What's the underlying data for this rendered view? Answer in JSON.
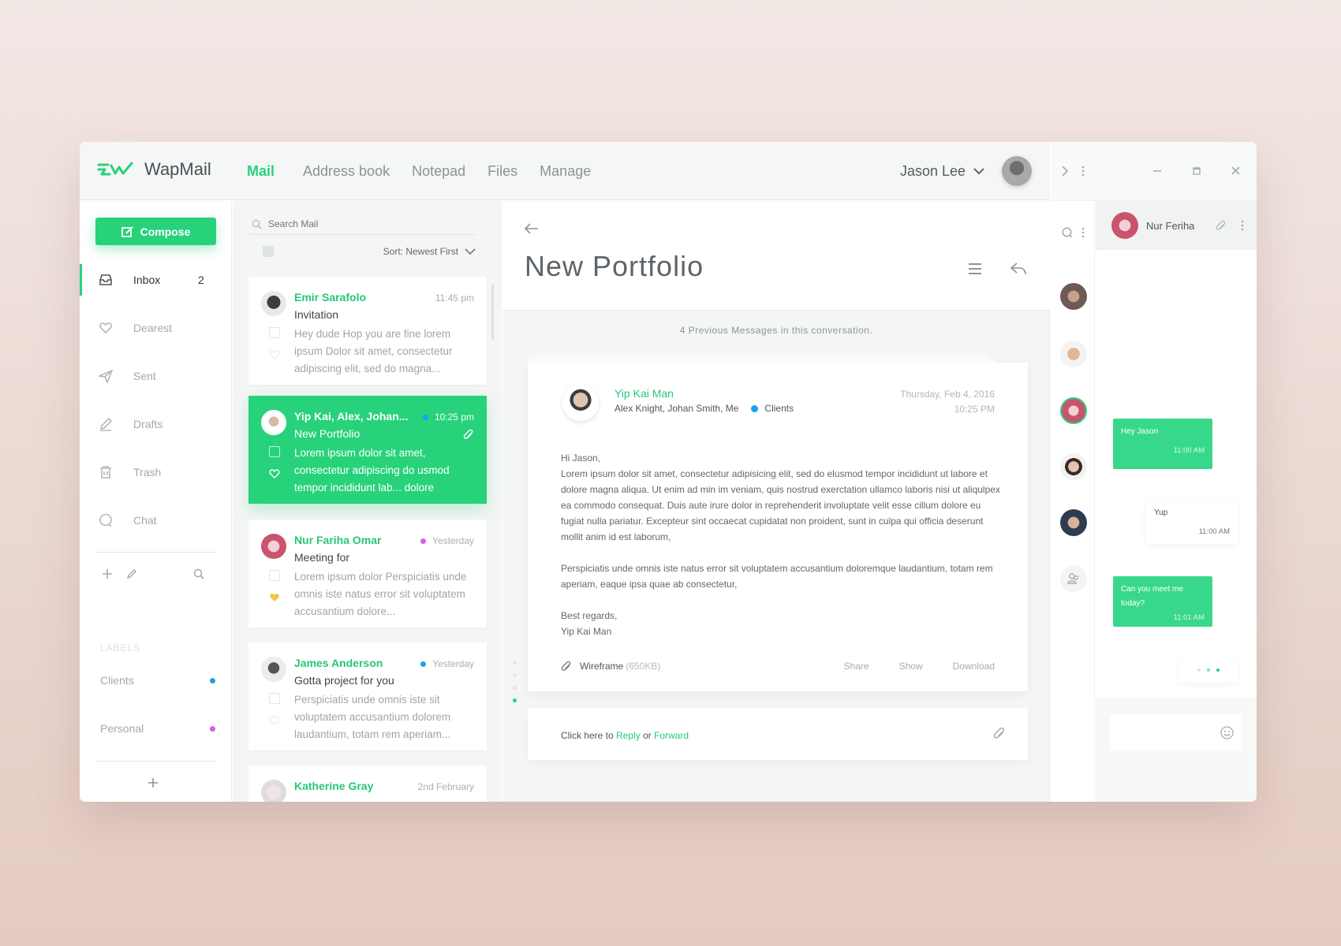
{
  "app": {
    "name": "WapMail"
  },
  "nav": {
    "items": [
      "Mail",
      "Address book",
      "Notepad",
      "Files",
      "Manage"
    ],
    "active": "Mail"
  },
  "user": {
    "name": "Jason Lee"
  },
  "sidebar": {
    "compose_label": "Compose",
    "folders": [
      {
        "label": "Inbox",
        "count": "2",
        "icon": "inbox-icon"
      },
      {
        "label": "Dearest",
        "icon": "heart-icon"
      },
      {
        "label": "Sent",
        "icon": "send-icon"
      },
      {
        "label": "Drafts",
        "icon": "pencil-icon"
      },
      {
        "label": "Trash",
        "icon": "trash-icon"
      },
      {
        "label": "Chat",
        "icon": "chat-icon"
      }
    ],
    "labels_heading": "LABELS",
    "labels": [
      {
        "label": "Clients",
        "color": "#1aa3e8"
      },
      {
        "label": "Personal",
        "color": "#d65cf0"
      }
    ]
  },
  "maillist": {
    "search_placeholder": "Search Mail",
    "sort_label": "Sort: Newest First",
    "items": [
      {
        "from": "Emir Sarafolo",
        "time": "11:45 pm",
        "subject": "Invitation",
        "preview": "Hey dude Hop you are fine lorem ipsum Dolor sit amet, consectetur adipiscing elit, sed do magna...",
        "dot": ""
      },
      {
        "from": "Yip Kai, Alex, Johan...",
        "time": "10:25 pm",
        "subject": "New Portfolio",
        "preview": "Lorem ipsum dolor sit amet, consectetur adipiscing do usmod tempor incididunt lab... dolore",
        "dot": "#1aa3e8"
      },
      {
        "from": "Nur Fariha Omar",
        "time": "Yesterday",
        "subject": "Meeting for",
        "preview": "Lorem ipsum dolor Perspiciatis unde omnis iste natus error sit voluptatem accusantium dolore...",
        "dot": "#d65cf0"
      },
      {
        "from": "James Anderson",
        "time": "Yesterday",
        "subject": "Gotta project for you",
        "preview": "Perspiciatis unde omnis iste sit voluptatem accusantium dolorem laudantium, totam rem aperiam...",
        "dot": "#1aa3e8"
      },
      {
        "from": "Katherine Gray",
        "time": "2nd February",
        "subject": "",
        "preview": "",
        "dot": ""
      }
    ]
  },
  "reader": {
    "title": "New Portfolio",
    "previous_note": "4 Previous Messages in this conversation.",
    "message": {
      "from": "Yip Kai Man",
      "to": "Alex Knight, Johan Smith, Me",
      "tag": "Clients",
      "date": "Thursday, Feb 4, 2016",
      "time": "10:25 PM",
      "greeting": "Hi Jason,",
      "para1": "Lorem ipsum dolor sit amet, consectetur adipisicing elit, sed do elusmod tempor incididunt ut labore et dolore magna aliqua. Ut enim ad min im veniam, quis nostrud exerctation ullamco laboris nisi ut aliqulpex ea commodo consequat. Duis aute irure dolor in reprehenderit involuptate velit esse cillum dolore eu fugiat nulla pariatur. Excepteur sint occaecat cupidatat non proident, sunt in culpa qui officia deserunt mollit anim id est laborum,",
      "para2": "Perspiciatis unde omnis iste natus error sit voluptatem accusantium doloremque laudantium, totam rem aperiam, eaque ipsa quae ab consectetur,",
      "signoff": "Best regards,",
      "signature": "Yip Kai Man",
      "attachment_name": "Wireframe",
      "attachment_size": "(650KB)",
      "actions": [
        "Share",
        "Show",
        "Download"
      ]
    },
    "reply": {
      "prefix": "Click here to",
      "reply": "Reply",
      "or": "or",
      "forward": "Forward"
    }
  },
  "chat": {
    "contact": "Nur Feriha",
    "messages": [
      {
        "dir": "in",
        "text": "Hey Jason",
        "time": "11:00 AM"
      },
      {
        "dir": "out",
        "text": "Yup",
        "time": "11:00 AM"
      },
      {
        "dir": "in",
        "text": "Can you meet me today?",
        "time": "11:01 AM"
      }
    ]
  },
  "colors": {
    "accent": "#27d27b",
    "clients": "#1aa3e8",
    "personal": "#d65cf0",
    "heart_active": "#f5c542"
  }
}
